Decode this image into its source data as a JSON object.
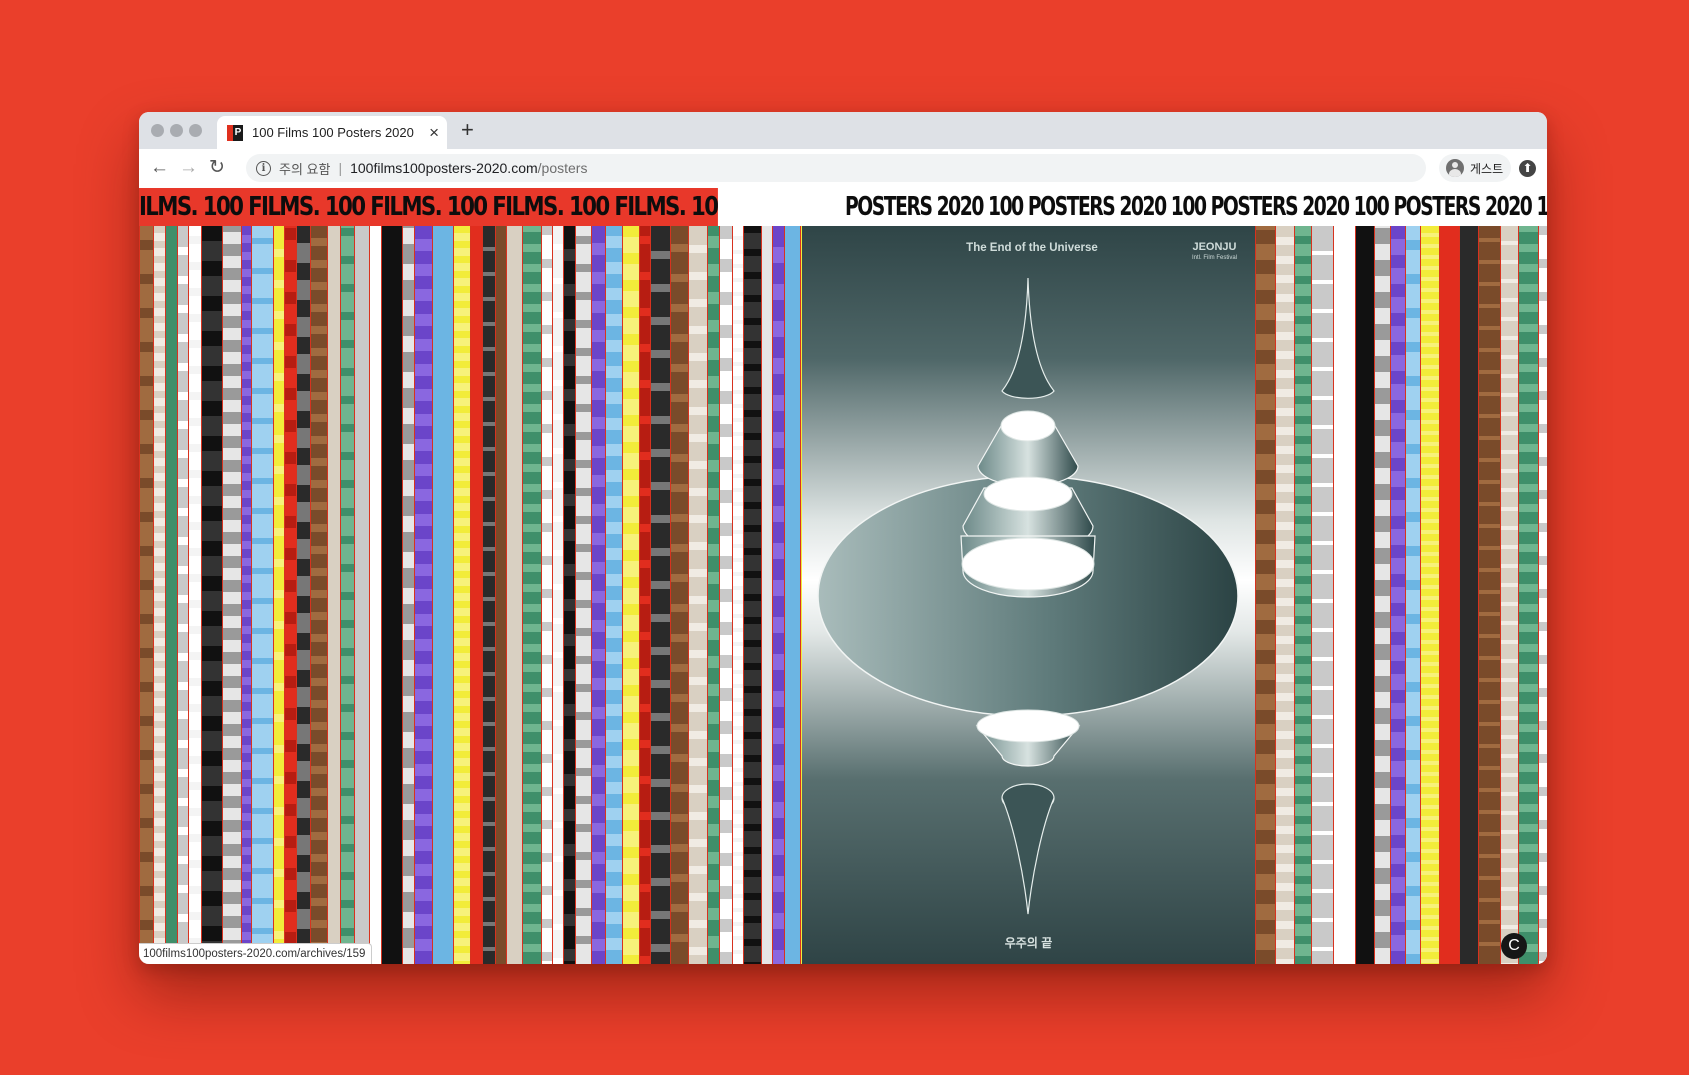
{
  "browser": {
    "tab_title": "100 Films 100 Posters 2020",
    "tab_close": "×",
    "new_tab": "+",
    "favicon_text": "P",
    "security_label": "주의 요함",
    "url_host": "100films100posters-2020.com",
    "url_path": "/posters",
    "profile_label": "게스트",
    "nav_back": "←",
    "nav_forward": "→",
    "nav_reload": "↻",
    "update_glyph": "⬆"
  },
  "page": {
    "banner_films": "ILMS. 100 FILMS. 100 FILMS. 100 FILMS. 100 FILMS. 100 FILMS. 100 FILMS. 10",
    "banner_posters": "POSTERS 2020  100 POSTERS 2020  100 POSTERS 2020  100 POSTERS 2020  100 POSTE",
    "featured_poster": {
      "title": "The End of the Universe",
      "festival": "JEONJU",
      "festival_sub": "Intl. Film Festival",
      "korean_title": "우주의 끝"
    },
    "status_link": "100films100posters-2020.com/archives/159",
    "corner_glyph": "C"
  },
  "colors": {
    "background": "#ea3f2b",
    "banner_red": "#e8382a",
    "poster_teal": "#3f5758"
  }
}
